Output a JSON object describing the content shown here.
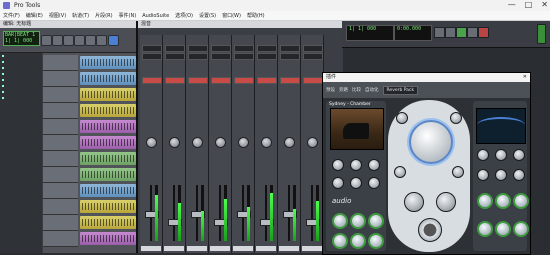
{
  "window": {
    "title": "Pro Tools",
    "minimize": "—",
    "maximize": "□",
    "close": "✕"
  },
  "menubar": {
    "items": [
      "文件(F)",
      "编辑(E)",
      "视图(V)",
      "轨道(T)",
      "片段(R)",
      "事件(N)",
      "AudioSuite",
      "选项(O)",
      "设置(S)",
      "窗口(W)",
      "帮助(H)"
    ]
  },
  "edit_window": {
    "title": "编辑: 无标题",
    "counter_lines": [
      "BAR|BEAT 1",
      "1| 1| 000"
    ]
  },
  "mix_window": {
    "title": "混音"
  },
  "transport": {
    "counter_main": "1| 1| 000",
    "counter_alt": "0:00.000"
  },
  "plugin": {
    "title": "插件",
    "close": "✕",
    "header_items": [
      "预设",
      "旁路",
      "比较",
      "自动化"
    ],
    "preset": "Reverb Pack",
    "left_label": "Sydney - Chamber",
    "brand": "audio"
  },
  "colors": {
    "accent": "#5a86c8",
    "meter": "#4cff4c",
    "clip_blue": "#8fb6d8"
  }
}
